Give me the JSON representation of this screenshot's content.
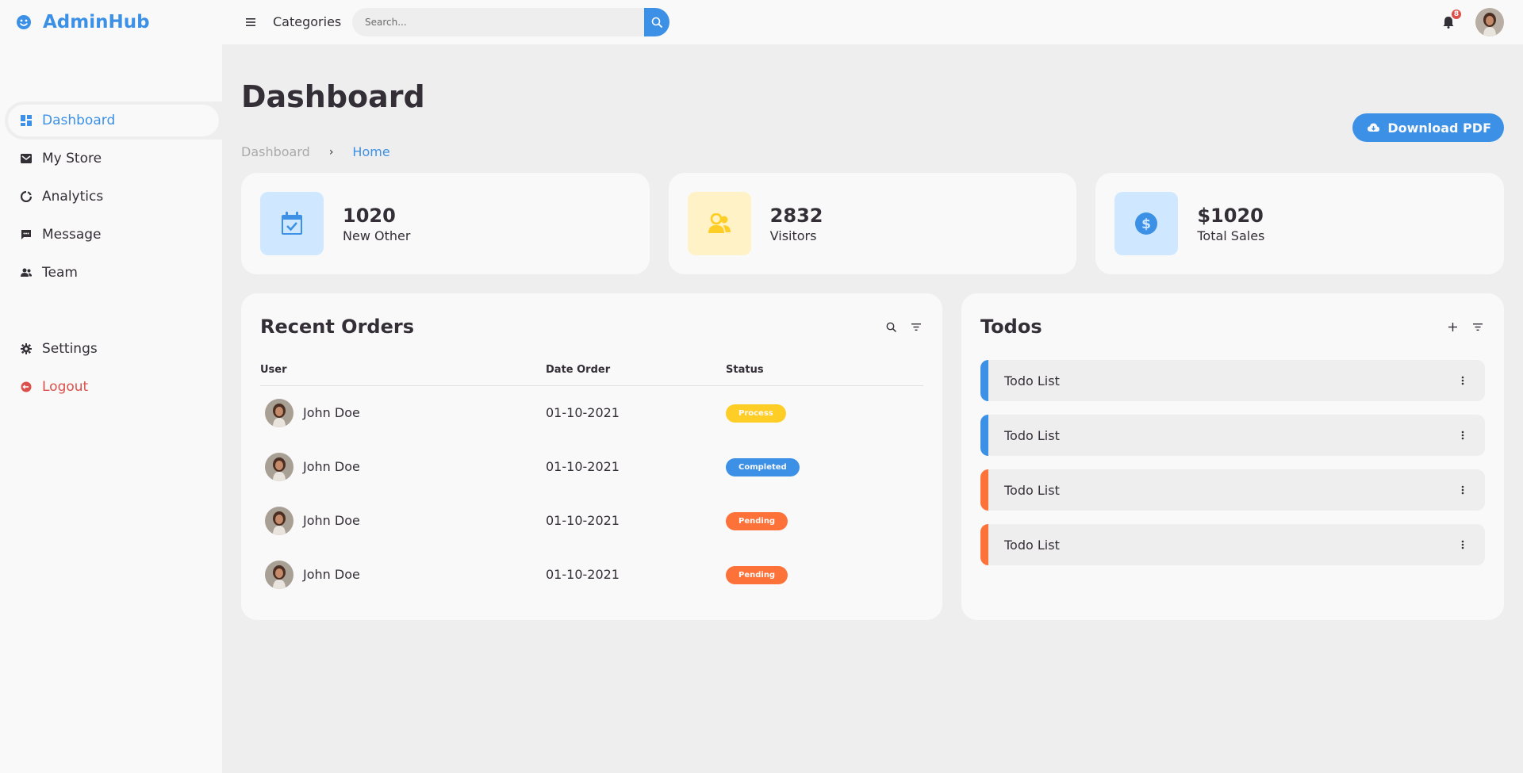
{
  "brand": {
    "name": "AdminHub",
    "icon": "smile-icon"
  },
  "sidebar": {
    "items": [
      {
        "label": "Dashboard",
        "icon": "dashboard-icon",
        "active": true
      },
      {
        "label": "My Store",
        "icon": "store-icon"
      },
      {
        "label": "Analytics",
        "icon": "analytics-icon"
      },
      {
        "label": "Message",
        "icon": "message-icon"
      },
      {
        "label": "Team",
        "icon": "team-icon"
      }
    ],
    "bottom_items": [
      {
        "label": "Settings",
        "icon": "gear-icon"
      },
      {
        "label": "Logout",
        "icon": "logout-icon"
      }
    ]
  },
  "navbar": {
    "categories_label": "Categories",
    "search_placeholder": "Search...",
    "notification_count": "8"
  },
  "main": {
    "title": "Dashboard",
    "breadcrumb": [
      "Dashboard",
      "Home"
    ],
    "download_label": "Download PDF"
  },
  "stats": [
    {
      "value": "1020",
      "label": "New Other",
      "icon": "calendar-check-icon"
    },
    {
      "value": "2832",
      "label": "Visitors",
      "icon": "group-icon"
    },
    {
      "value": "$1020",
      "label": "Total Sales",
      "icon": "dollar-circle-icon"
    }
  ],
  "orders": {
    "title": "Recent Orders",
    "columns": [
      "User",
      "Date Order",
      "Status"
    ],
    "rows": [
      {
        "user": "John Doe",
        "date": "01-10-2021",
        "status": "Process"
      },
      {
        "user": "John Doe",
        "date": "01-10-2021",
        "status": "Completed"
      },
      {
        "user": "John Doe",
        "date": "01-10-2021",
        "status": "Pending"
      },
      {
        "user": "John Doe",
        "date": "01-10-2021",
        "status": "Pending"
      }
    ]
  },
  "todos": {
    "title": "Todos",
    "items": [
      {
        "label": "Todo List",
        "state": "completed"
      },
      {
        "label": "Todo List",
        "state": "completed"
      },
      {
        "label": "Todo List",
        "state": "not-completed"
      },
      {
        "label": "Todo List",
        "state": "not-completed"
      }
    ]
  },
  "colors": {
    "blue": "#3C91E6",
    "light_blue": "#CFE8FF",
    "yellow": "#FFCE26",
    "light_yellow": "#FFF2C6",
    "orange": "#FD7238",
    "red": "#DB504A",
    "dark": "#342E37",
    "grey": "#EEEEEE",
    "light": "#F9F9F9"
  }
}
